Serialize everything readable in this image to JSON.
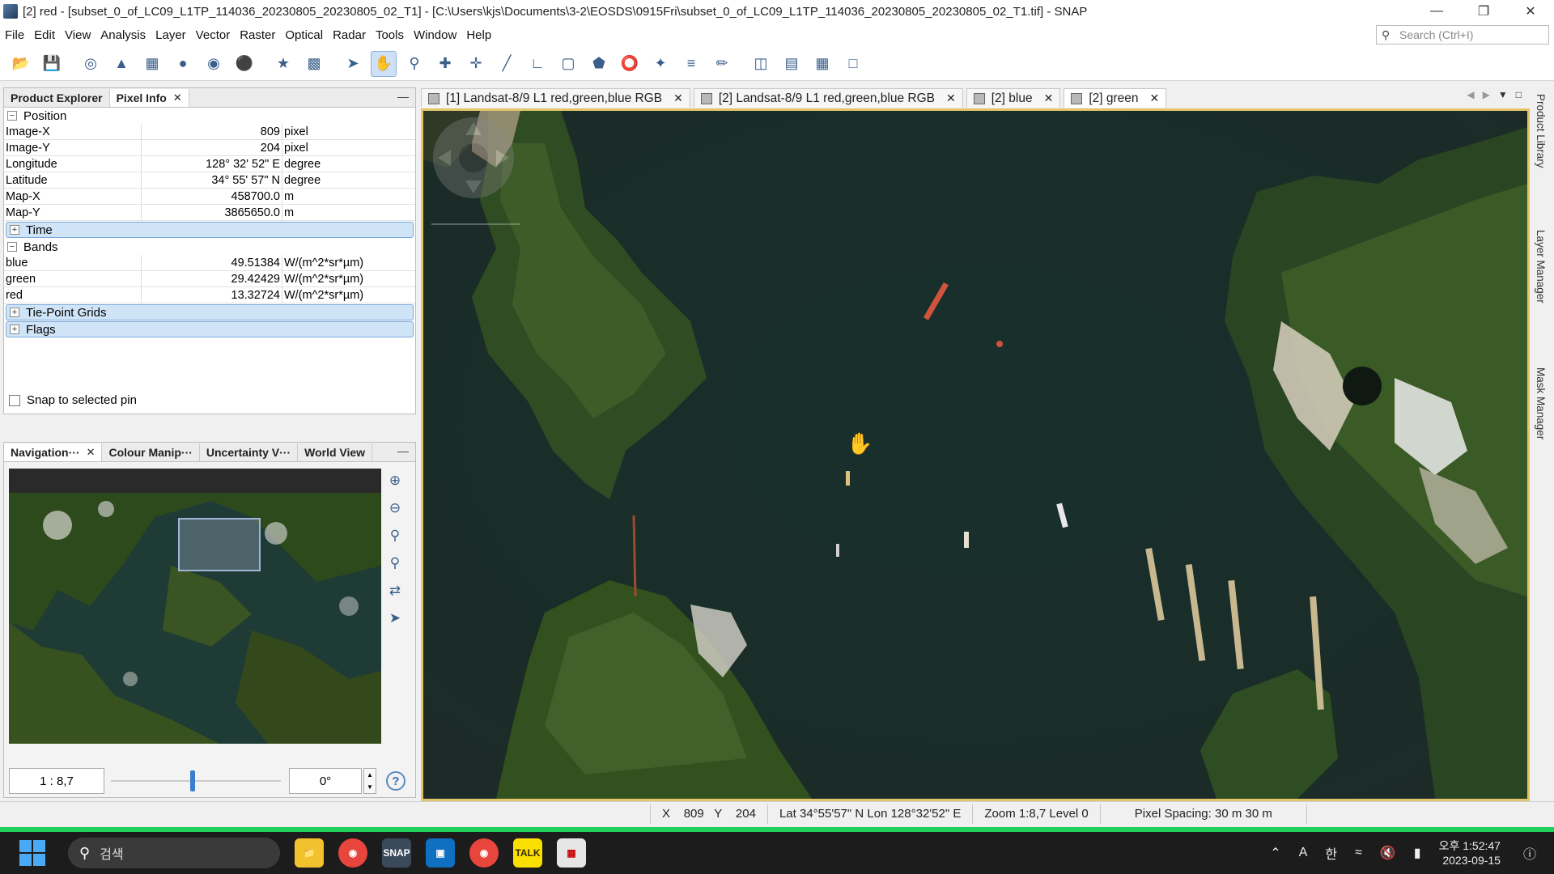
{
  "window": {
    "title": "[2] red - [subset_0_of_LC09_L1TP_114036_20230805_20230805_02_T1] - [C:\\Users\\kjs\\Documents\\3-2\\EOSDS\\0915Fri\\subset_0_of_LC09_L1TP_114036_20230805_20230805_02_T1.tif] - SNAP"
  },
  "menu": [
    "File",
    "Edit",
    "View",
    "Analysis",
    "Layer",
    "Vector",
    "Raster",
    "Optical",
    "Tools",
    "Radar",
    "Window",
    "Help"
  ],
  "search": {
    "placeholder": "Search (Ctrl+I)"
  },
  "left_panel": {
    "tabs": {
      "product_explorer": "Product Explorer",
      "pixel_info": "Pixel Info"
    },
    "position_group": "Position",
    "position_rows": [
      {
        "name": "Image-X",
        "value": "809",
        "unit": "pixel"
      },
      {
        "name": "Image-Y",
        "value": "204",
        "unit": "pixel"
      },
      {
        "name": "Longitude",
        "value": "128° 32' 52\" E",
        "unit": "degree"
      },
      {
        "name": "Latitude",
        "value": "34° 55' 57\" N",
        "unit": "degree"
      },
      {
        "name": "Map-X",
        "value": "458700.0",
        "unit": "m"
      },
      {
        "name": "Map-Y",
        "value": "3865650.0",
        "unit": "m"
      }
    ],
    "time_group": "Time",
    "bands_group": "Bands",
    "band_rows": [
      {
        "name": "blue",
        "value": "49.51384",
        "unit": "W/(m^2*sr*µm)"
      },
      {
        "name": "green",
        "value": "29.42429",
        "unit": "W/(m^2*sr*µm)"
      },
      {
        "name": "red",
        "value": "13.32724",
        "unit": "W/(m^2*sr*µm)"
      }
    ],
    "tiepoint_group": "Tie-Point Grids",
    "flags_group": "Flags",
    "snap_label": "Snap to selected pin"
  },
  "nav_panel": {
    "tabs": {
      "navigation": "Navigation···",
      "colour": "Colour Manip···",
      "uncertainty": "Uncertainty V···",
      "world": "World View"
    },
    "scale": "1 : 8,7",
    "rotation": "0°"
  },
  "view_tabs": [
    "[1] Landsat-8/9 L1 red,green,blue RGB",
    "[2] Landsat-8/9 L1 red,green,blue RGB",
    "[2] blue",
    "[2] green"
  ],
  "right_sidebar": [
    "Product Library",
    "Layer Manager",
    "Mask Manager"
  ],
  "status": {
    "x_label": "X",
    "x_value": "809",
    "y_label": "Y",
    "y_value": "204",
    "latlon": "Lat 34°55'57\" N  Lon 128°32'52\" E",
    "zoom": "Zoom 1:8,7  Level 0",
    "spacing": "Pixel Spacing: 30 m 30 m"
  },
  "taskbar": {
    "search_label": "검색",
    "apps": [
      "file-explorer",
      "chrome",
      "snap",
      "app-blue",
      "chrome-2",
      "kakaotalk",
      "app-window"
    ],
    "ime_a": "A",
    "ime_lang": "한",
    "clock_time": "오후 1:52:47",
    "clock_date": "2023-09-15"
  },
  "colors": {
    "accent": "#3a7fcf",
    "image_border": "#e3c66a",
    "status_green": "#1fd15b"
  }
}
